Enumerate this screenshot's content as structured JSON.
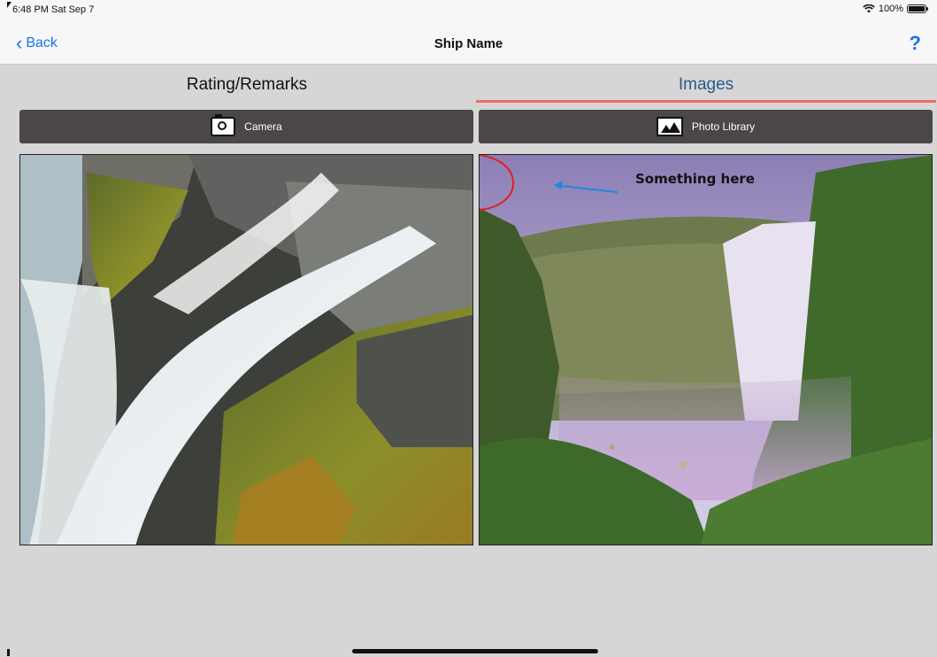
{
  "status": {
    "time": "6:48 PM  Sat Sep 7",
    "battery": "100%"
  },
  "nav": {
    "back_label": "Back",
    "title": "Ship Name",
    "help_label": "?"
  },
  "tabs": [
    {
      "label": "Rating/Remarks",
      "selected": false
    },
    {
      "label": "Images",
      "selected": true
    }
  ],
  "buttons": {
    "camera_label": "Camera",
    "library_label": "Photo Library"
  },
  "photos": {
    "annotation_text": "Something here"
  },
  "colors": {
    "accent": "#1a73e8",
    "tab_underline": "#f16f5e",
    "button_bg": "#4a4746",
    "background": "#d6d6d6"
  },
  "icons": [
    "back-chevron-icon",
    "wifi-icon",
    "battery-icon",
    "camera-icon",
    "photo-library-icon"
  ]
}
